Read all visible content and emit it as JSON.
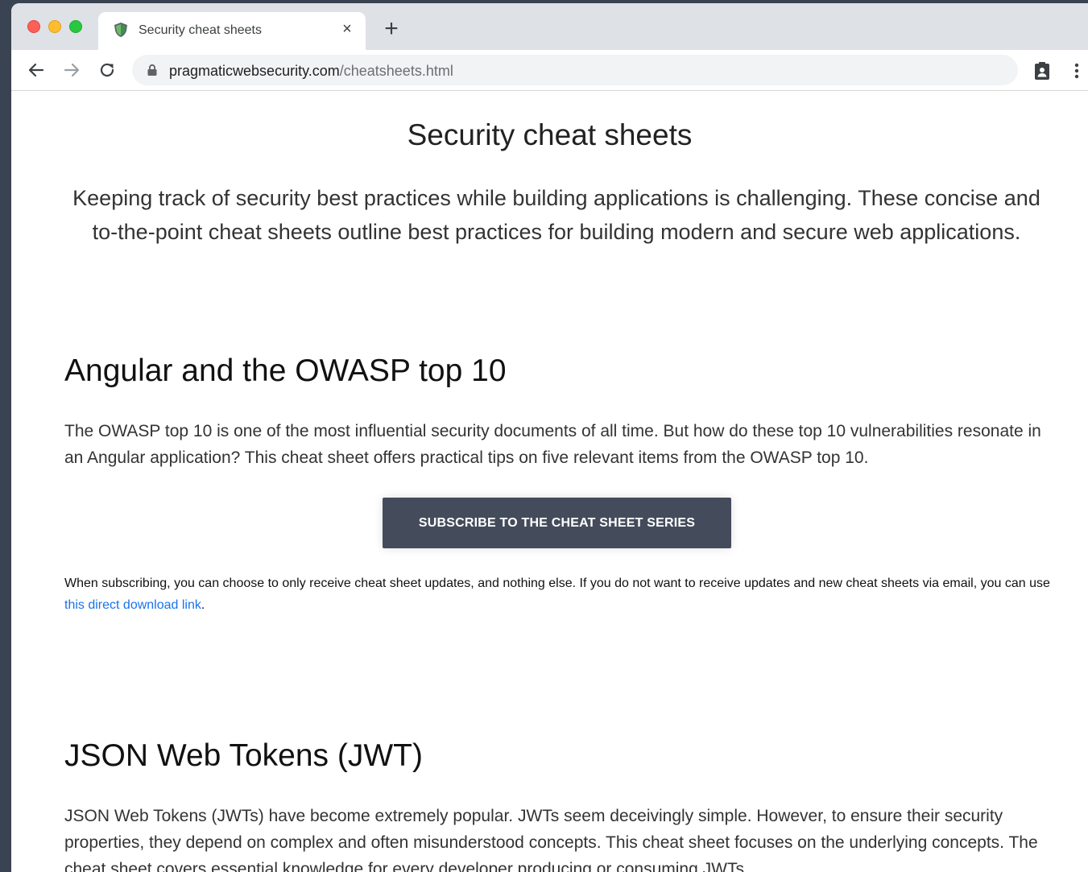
{
  "browser": {
    "tab_title": "Security cheat sheets",
    "tab_close": "×",
    "new_tab": "+",
    "url_domain": "pragmaticwebsecurity.com",
    "url_path": "/cheatsheets.html"
  },
  "page": {
    "title": "Security cheat sheets",
    "intro": "Keeping track of security best practices while building applications is challenging. These concise and to-the-point cheat sheets outline best practices for building modern and secure web applications.",
    "sections": [
      {
        "heading": "Angular and the OWASP top 10",
        "text": "The OWASP top 10 is one of the most influential security documents of all time. But how do these top 10 vulnerabilities resonate in an Angular application? This cheat sheet offers practical tips on five relevant items from the OWASP top 10.",
        "button_label": "SUBSCRIBE TO THE CHEAT SHEET SERIES",
        "note_text": "When subscribing, you can choose to only receive cheat sheet updates, and nothing else. If you do not want to receive updates and new cheat sheets via email, you can use ",
        "note_link": "this direct download link",
        "note_end": "."
      },
      {
        "heading": "JSON Web Tokens (JWT)",
        "text": "JSON Web Tokens (JWTs) have become extremely popular. JWTs seem deceivingly simple. However, to ensure their security properties, they depend on complex and often misunderstood concepts. This cheat sheet focuses on the underlying concepts. The cheat sheet covers essential knowledge for every developer producing or consuming JWTs."
      }
    ]
  },
  "icons": {
    "favicon": "shield-icon",
    "back": "arrow-left-icon",
    "forward": "arrow-right-icon",
    "reload": "reload-icon",
    "lock": "lock-icon",
    "extension": "clipboard-badge-icon",
    "menu": "vertical-dots-icon"
  }
}
